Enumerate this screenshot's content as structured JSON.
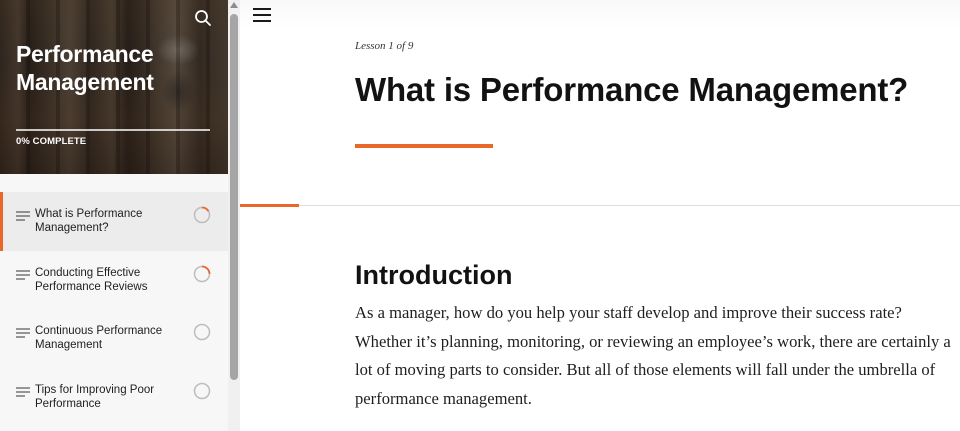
{
  "course": {
    "title": "Performance Management",
    "progress_label": "0% COMPLETE",
    "progress_fraction": 0.0
  },
  "lessons": [
    {
      "label": "What is Performance Management?",
      "state": "active",
      "status_icon": "progress-ring-partial-icon"
    },
    {
      "label": "Conducting Effective Performance Reviews",
      "state": "default",
      "status_icon": "progress-ring-partial-icon"
    },
    {
      "label": "Continuous Performance Management",
      "state": "default",
      "status_icon": "progress-ring-empty-icon"
    },
    {
      "label": "Tips for Improving Poor Performance",
      "state": "default",
      "status_icon": "progress-ring-empty-icon"
    }
  ],
  "lesson_header": {
    "counter": "Lesson 1 of 9",
    "title": "What is Performance Management?"
  },
  "content": {
    "heading": "Introduction",
    "body": "As a manager, how do you help your staff develop and improve their success rate? Whether it’s planning, monitoring, or reviewing an employee’s work, there are certainly a lot of moving parts to consider. But all of those elements will fall under the umbrella of performance management."
  },
  "colors": {
    "accent": "#e8682c",
    "sidebar_bg": "#f7f7f7",
    "active_item_bg": "#ececec",
    "scroll_thumb": "#a5a5a5"
  },
  "icons": {
    "search": "search-icon",
    "menu": "hamburger-menu-icon",
    "lesson_type": "lines-icon",
    "scroll_up": "triangle-up-icon"
  }
}
